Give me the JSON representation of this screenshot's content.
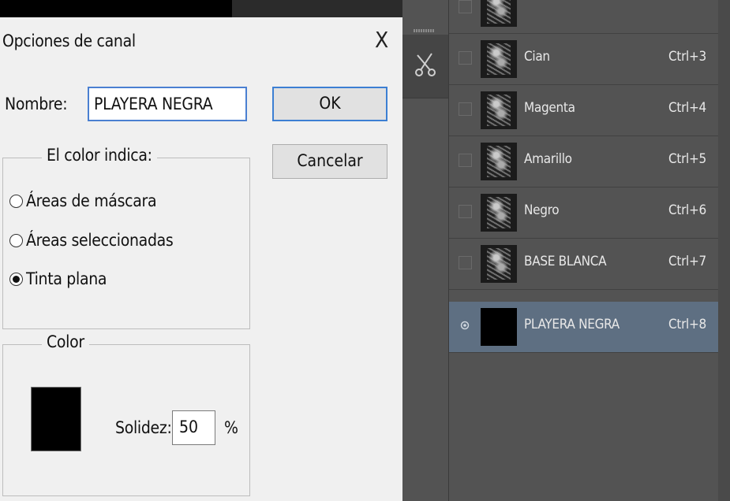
{
  "dialog": {
    "title": "Opciones de canal",
    "close_glyph": "X",
    "name_label": "Nombre:",
    "name_value": "PLAYERA NEGRA",
    "ok_label": "OK",
    "cancel_label": "Cancelar",
    "color_indicates": {
      "legend": "El color indica:",
      "options": [
        "Áreas de máscara",
        "Áreas seleccionadas",
        "Tinta plana"
      ],
      "selected_option": "Tinta plana"
    },
    "color_group": {
      "legend": "Color",
      "swatch_color": "#000000",
      "solidity_label": "Solidez:",
      "solidity_value": "50",
      "percent_sign": "%"
    }
  },
  "channels_panel": {
    "tool_icon": "scissors-icon",
    "channels": [
      {
        "name": "Cian",
        "shortcut": "Ctrl+3",
        "visible": false,
        "selected": false
      },
      {
        "name": "Magenta",
        "shortcut": "Ctrl+4",
        "visible": false,
        "selected": false
      },
      {
        "name": "Amarillo",
        "shortcut": "Ctrl+5",
        "visible": false,
        "selected": false
      },
      {
        "name": "Negro",
        "shortcut": "Ctrl+6",
        "visible": false,
        "selected": false
      },
      {
        "name": "BASE BLANCA",
        "shortcut": "Ctrl+7",
        "visible": false,
        "selected": false
      },
      {
        "name": "PLAYERA NEGRA",
        "shortcut": "Ctrl+8",
        "visible": true,
        "selected": true
      }
    ]
  },
  "colors": {
    "selected_row": "#5e6f82",
    "panel_bg": "#535353",
    "ok_border": "#3c7fd3"
  }
}
